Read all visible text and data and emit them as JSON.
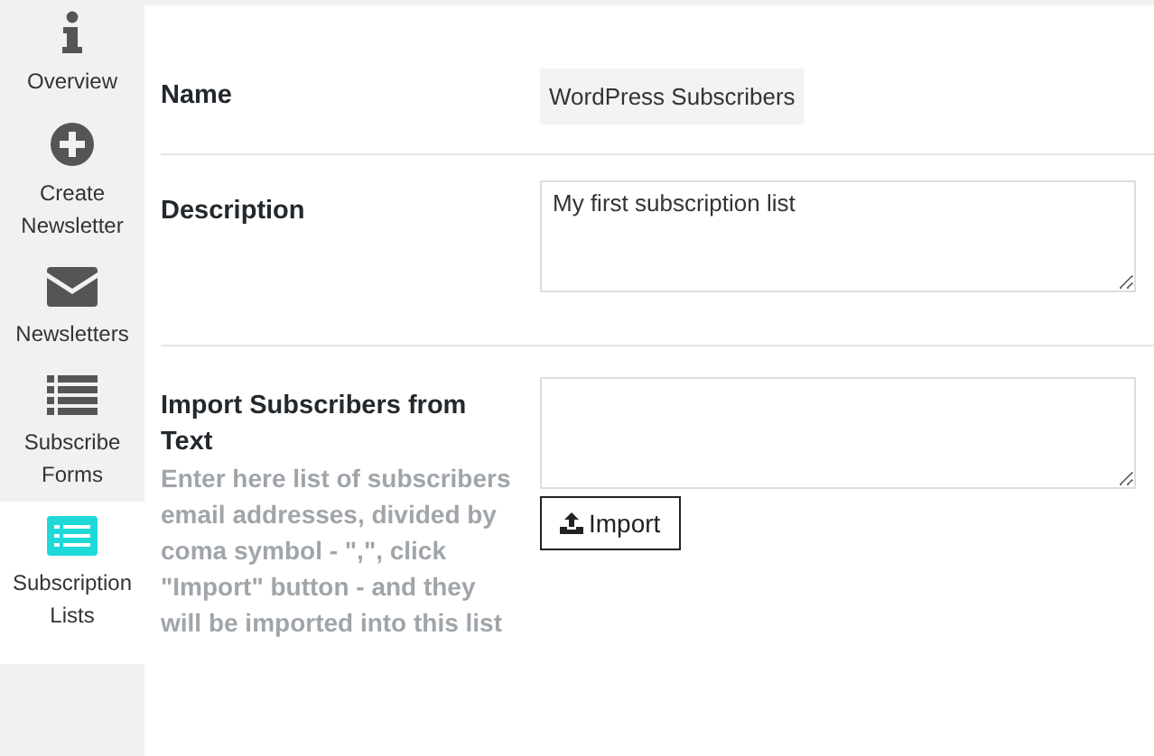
{
  "sidebar": {
    "items": [
      {
        "kind": "info",
        "label": "Overview",
        "selected": false
      },
      {
        "kind": "plus",
        "label": "Create Newsletter",
        "selected": false
      },
      {
        "kind": "envelope",
        "label": "Newsletters",
        "selected": false
      },
      {
        "kind": "list",
        "label": "Subscribe Forms",
        "selected": false
      },
      {
        "kind": "listbox",
        "label": "Subscription Lists",
        "selected": true
      }
    ]
  },
  "form": {
    "rows": [
      {
        "kind": "text",
        "label": "Name",
        "value": "WordPress Subscribers"
      },
      {
        "kind": "textarea",
        "label": "Description",
        "value": "My first subscription list"
      },
      {
        "kind": "import",
        "label": "Import Subscribers from Text",
        "help": "Enter here list of subscribers email addresses, divided by coma symbol - \",\", click \"Import\" button - and they will be imported into this list",
        "button": "Import"
      }
    ]
  }
}
